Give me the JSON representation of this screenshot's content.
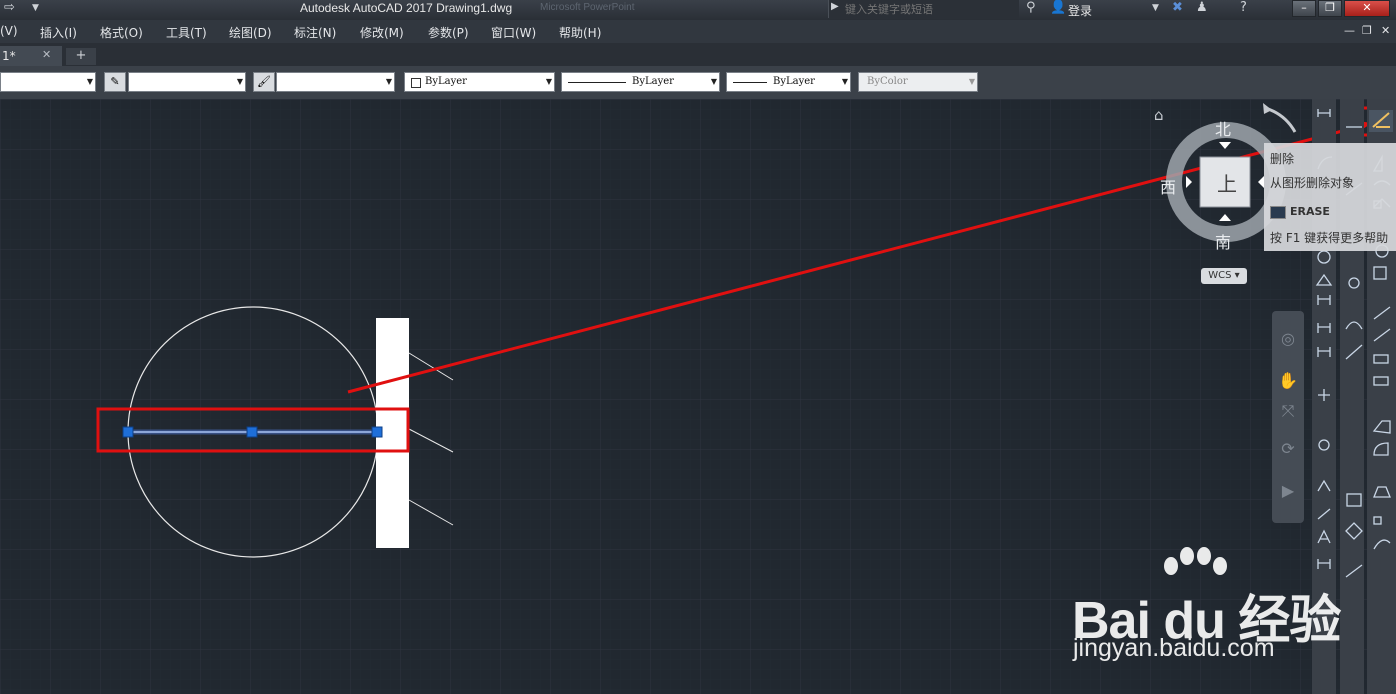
{
  "titlebar": {
    "title": "Autodesk AutoCAD 2017    Drawing1.dwg",
    "ghost": "Microsoft PowerPoint",
    "search_placeholder": "键入关键字或短语",
    "login": "登录"
  },
  "menu": {
    "items": [
      "(V)",
      "插入(I)",
      "格式(O)",
      "工具(T)",
      "绘图(D)",
      "标注(N)",
      "修改(M)",
      "参数(P)",
      "窗口(W)",
      "帮助(H)"
    ]
  },
  "tabs": {
    "active_label": "1*",
    "add_symbol": "+"
  },
  "properties": {
    "color": "ByLayer",
    "linetype": "ByLayer",
    "lineweight": "ByLayer",
    "plotstyle": "ByColor"
  },
  "viewcube": {
    "north": "北",
    "south": "南",
    "west": "西",
    "face": "上",
    "wcs": "WCS"
  },
  "tooltip": {
    "title": "删除",
    "description": "从图形删除对象",
    "command": "ERASE",
    "help": "按 F1 键获得更多帮助"
  },
  "watermark": {
    "brand": "Bai du 经验",
    "site": "jingyan.baidu.com"
  },
  "colors": {
    "canvas": "#212830",
    "annotation_red": "#e01010",
    "selected_line": "#6f8fd8",
    "grip": "#1e6fd9"
  },
  "icons": [
    "home-icon",
    "search-icon",
    "user-icon",
    "help-icon",
    "erase-icon",
    "pan-icon",
    "zoom-icon",
    "orbit-icon"
  ]
}
